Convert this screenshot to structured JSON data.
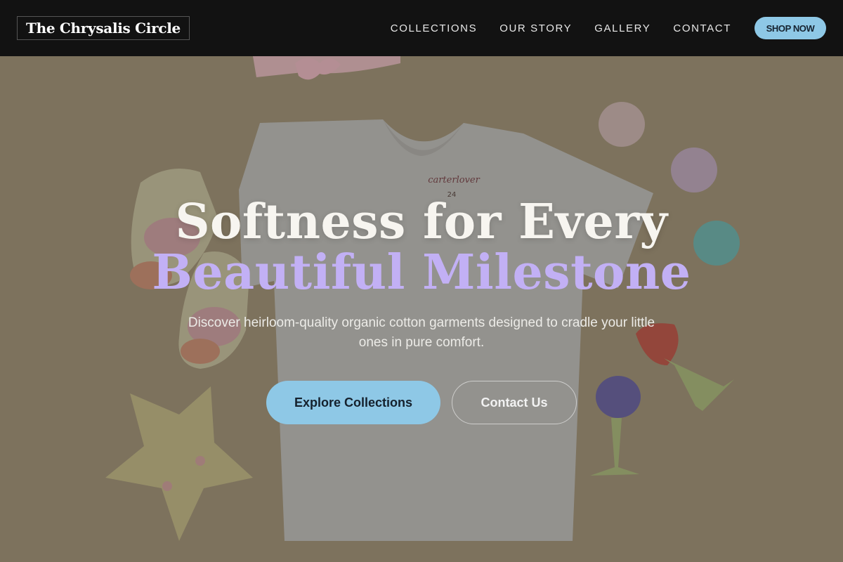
{
  "header": {
    "logo": "The Chrysalis Circle",
    "nav": [
      "COLLECTIONS",
      "OUR STORY",
      "GALLERY",
      "CONTACT"
    ],
    "cta": "SHOP NOW"
  },
  "hero": {
    "headline_line1": "Softness for Every",
    "headline_line2": "Beautiful Milestone",
    "subtitle": "Discover heirloom-quality organic cotton garments designed to cradle your little ones in pure comfort.",
    "primary_button": "Explore Collections",
    "secondary_button": "Contact Us",
    "tshirt_tag_brand": "carterlover",
    "tshirt_tag_size": "24"
  },
  "colors": {
    "header_bg": "#121212",
    "accent_blue": "#8ec8e6",
    "headline_purple": "#c2b0f5",
    "hero_bg": "#8a7f68"
  }
}
